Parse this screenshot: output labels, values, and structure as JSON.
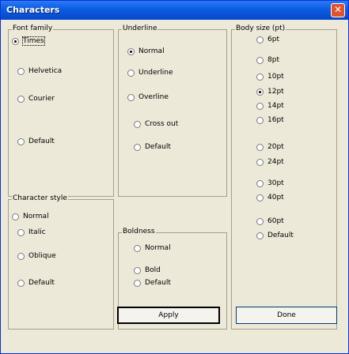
{
  "window": {
    "title": "Characters",
    "close_glyph": "✕"
  },
  "font_family": {
    "legend": "Font family",
    "options": [
      "Times",
      "Helvetica",
      "Courier",
      "Default"
    ],
    "selected": "Times"
  },
  "underline": {
    "legend": "Underline",
    "options": [
      "Normal",
      "Underline",
      "Overline",
      "Cross out",
      "Default"
    ],
    "selected": "Normal"
  },
  "body_size": {
    "legend": "Body size (pt)",
    "options": [
      "6pt",
      "8pt",
      "10pt",
      "12pt",
      "14pt",
      "16pt",
      "20pt",
      "24pt",
      "30pt",
      "40pt",
      "60pt",
      "Default"
    ],
    "selected": "12pt"
  },
  "character_style": {
    "legend": "Character style",
    "options": [
      "Normal",
      "Italic",
      "Oblique",
      "Default"
    ]
  },
  "boldness": {
    "legend": "Boldness",
    "options": [
      "Normal",
      "Bold",
      "Default"
    ]
  },
  "buttons": {
    "apply": "Apply",
    "done": "Done"
  }
}
